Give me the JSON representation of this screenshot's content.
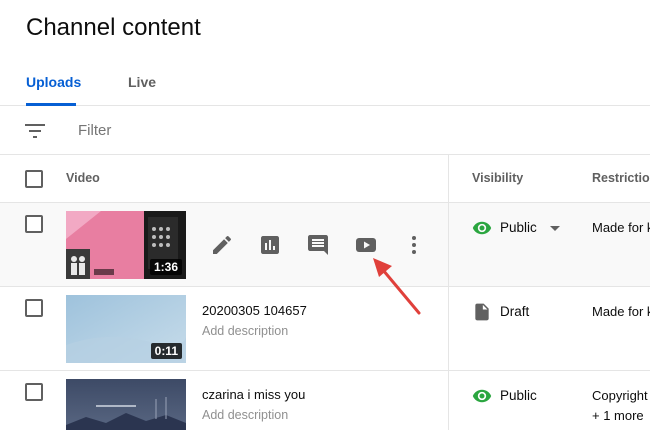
{
  "page": {
    "title": "Channel content"
  },
  "tabs": [
    {
      "label": "Uploads",
      "active": true
    },
    {
      "label": "Live",
      "active": false
    }
  ],
  "filter": {
    "placeholder": "Filter",
    "icon": "filter-list-icon"
  },
  "table": {
    "headers": {
      "video": "Video",
      "visibility": "Visibility",
      "restrictions": "Restrictions"
    },
    "rows": [
      {
        "title": "",
        "description": "",
        "duration": "1:36",
        "visibility": "Public",
        "visibility_icon": "eye-icon",
        "restriction": "Made for kids",
        "restriction_more": "",
        "hovered": true,
        "actions": [
          "edit-icon",
          "analytics-icon",
          "comments-icon",
          "youtube-play-icon",
          "more-vert-icon"
        ]
      },
      {
        "title": "20200305 104657",
        "description": "Add description",
        "duration": "0:11",
        "visibility": "Draft",
        "visibility_icon": "draft-document-icon",
        "restriction": "Made for kids",
        "restriction_more": ""
      },
      {
        "title": "czarina i miss you",
        "description": "Add description",
        "duration": "",
        "visibility": "Public",
        "visibility_icon": "eye-icon",
        "restriction": "Copyright",
        "restriction_more": "+ 1 more"
      }
    ]
  },
  "colors": {
    "accent": "#065fd4",
    "public_green": "#2ba640",
    "arrow_red": "#e0403b"
  }
}
